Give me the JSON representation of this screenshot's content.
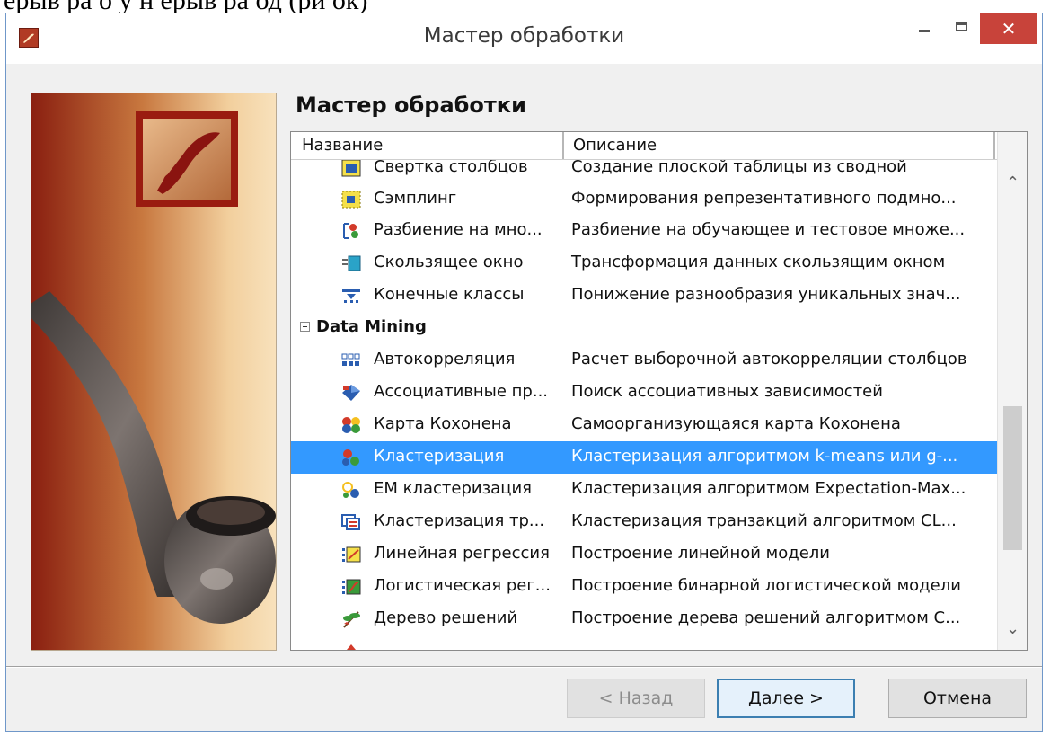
{
  "window": {
    "title": "Мастер обработки",
    "caption_fragment": "ерыв   ра  о     у    н    ерыв   ра  од  (ри  ок)"
  },
  "page": {
    "heading": "Мастер обработки"
  },
  "list": {
    "columns": [
      "Название",
      "Описание"
    ],
    "rows": [
      {
        "kind": "item",
        "icon": "pivot-icon",
        "name": "Свертка столбцов",
        "desc": "Создание плоской таблицы из сводной"
      },
      {
        "kind": "item",
        "icon": "sampling-icon",
        "name": "Сэмплинг",
        "desc": "Формирования репрезентативного подмно..."
      },
      {
        "kind": "item",
        "icon": "partition-icon",
        "name": "Разбиение на мно...",
        "desc": "Разбиение на обучающее и тестовое множе..."
      },
      {
        "kind": "item",
        "icon": "sliding-window-icon",
        "name": "Скользящее окно",
        "desc": "Трансформация данных скользящим окном"
      },
      {
        "kind": "item",
        "icon": "final-classes-icon",
        "name": "Конечные классы",
        "desc": "Понижение разнообразия уникальных знач..."
      },
      {
        "kind": "group",
        "name": "Data Mining",
        "desc": ""
      },
      {
        "kind": "item",
        "icon": "autocorrelation-icon",
        "name": "Автокорреляция",
        "desc": "Расчет выборочной автокорреляции столбцов"
      },
      {
        "kind": "item",
        "icon": "association-icon",
        "name": "Ассоциативные пр...",
        "desc": "Поиск ассоциативных зависимостей"
      },
      {
        "kind": "item",
        "icon": "kohonen-map-icon",
        "name": "Карта Кохонена",
        "desc": "Самоорганизующаяся карта Кохонена"
      },
      {
        "kind": "item",
        "icon": "clustering-icon",
        "name": "Кластеризация",
        "desc": "Кластеризация алгоритмом k-means или g-...",
        "selected": true
      },
      {
        "kind": "item",
        "icon": "em-clustering-icon",
        "name": "ЕМ кластеризация",
        "desc": "Кластеризация алгоритмом Expectation-Max..."
      },
      {
        "kind": "item",
        "icon": "transaction-clustering-icon",
        "name": "Кластеризация тр...",
        "desc": "Кластеризация транзакций алгоритмом CL..."
      },
      {
        "kind": "item",
        "icon": "linear-regression-icon",
        "name": "Линейная регрессия",
        "desc": "Построение линейной модели"
      },
      {
        "kind": "item",
        "icon": "logistic-regression-icon",
        "name": "Логистическая рег...",
        "desc": "Построение бинарной логистической модели"
      },
      {
        "kind": "item",
        "icon": "decision-tree-icon",
        "name": "Дерево решений",
        "desc": "Построение дерева решений алгоритмом С..."
      }
    ]
  },
  "buttons": {
    "back": "< Назад",
    "next": "Далее >",
    "cancel": "Отмена"
  },
  "colors": {
    "selection": "#3399ff",
    "close_button": "#c8433a",
    "accent_border": "#3c7fb1"
  }
}
